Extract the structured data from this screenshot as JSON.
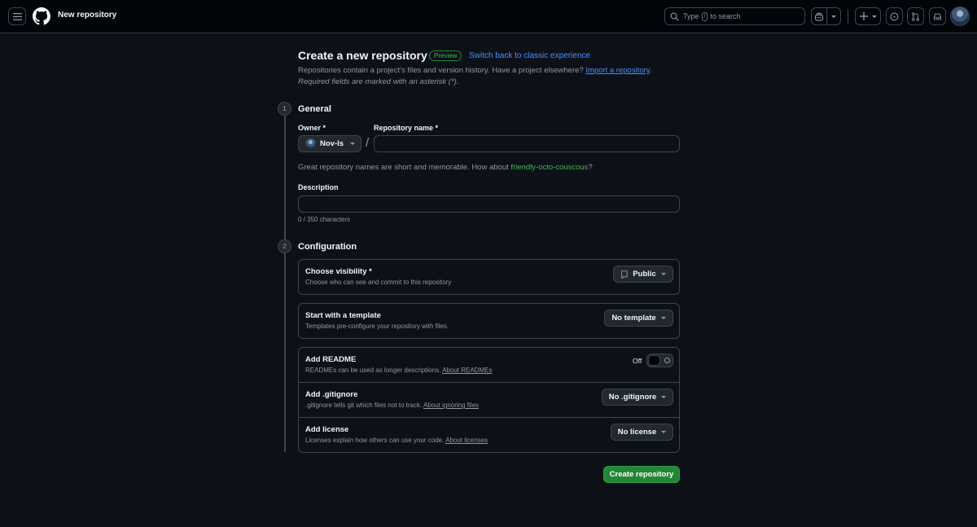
{
  "header": {
    "page_name": "New repository",
    "search": {
      "prefix": "Type",
      "key": "/",
      "suffix": "to search"
    }
  },
  "main": {
    "title": "Create a new repository",
    "preview_badge": "Preview",
    "switch_link": "Switch back to classic experience",
    "subtitle_text": "Repositories contain a project's files and version history. Have a project elsewhere?",
    "import_link": "Import a repository",
    "subtitle_end": ".",
    "required_note": "Required fields are marked with an asterisk (*).",
    "general": {
      "step": "1",
      "title": "General",
      "owner_label": "Owner *",
      "owner_value": "Nov-ls",
      "slash": "/",
      "repo_name_label": "Repository name *",
      "repo_name_value": "",
      "hint_text": "Great repository names are short and memorable. How about",
      "hint_suggestion": "friendly-octo-couscous",
      "hint_end": "?",
      "description_label": "Description",
      "description_value": "",
      "char_count": "0 / 350 characters"
    },
    "configuration": {
      "step": "2",
      "title": "Configuration",
      "visibility": {
        "title": "Choose visibility *",
        "desc": "Choose who can see and commit to this repository",
        "value": "Public"
      },
      "template": {
        "title": "Start with a template",
        "desc": "Templates pre-configure your repository with files.",
        "value": "No template"
      },
      "readme": {
        "title": "Add README",
        "desc": "READMEs can be used as longer descriptions.",
        "link": "About READMEs",
        "toggle_label": "Off"
      },
      "gitignore": {
        "title": "Add .gitignore",
        "desc": ".gitignore tells git which files not to track.",
        "link": "About ignoring files",
        "value": "No .gitignore"
      },
      "license": {
        "title": "Add license",
        "desc": "Licenses explain how others can use your code.",
        "link": "About licenses",
        "value": "No license"
      }
    },
    "create_button": "Create repository"
  },
  "colors": {
    "background": "#0d1117",
    "header_bg": "#010409",
    "border": "#3d444d",
    "link": "#4493f8",
    "success": "#238636",
    "suggestion": "#3fb950"
  }
}
